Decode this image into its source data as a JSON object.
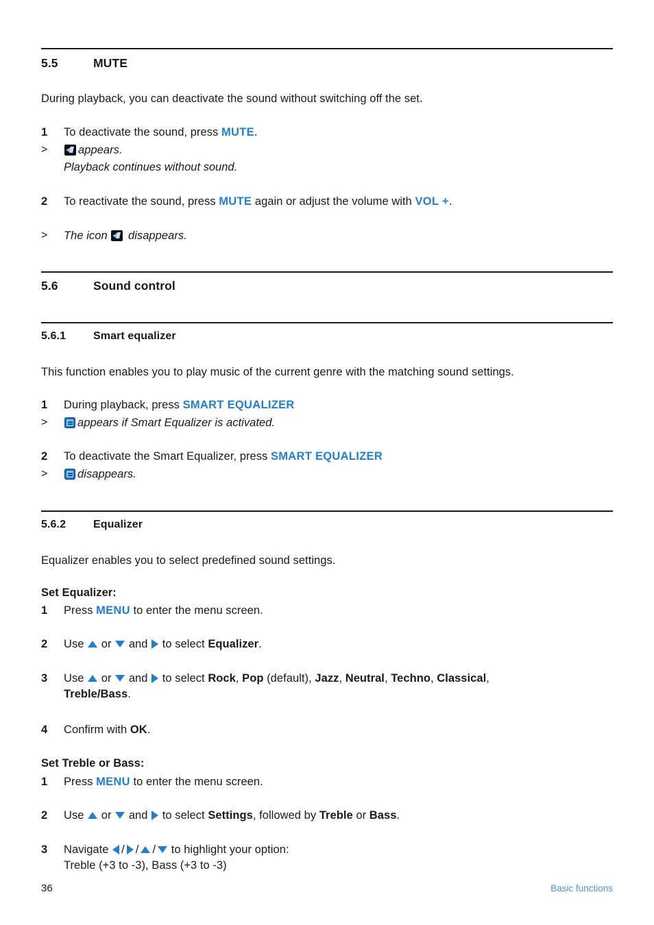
{
  "document": {
    "page_number": "36",
    "footer_section": "Basic functions",
    "accent_color": "#1f7fd1",
    "footer_color": "#4a90d9"
  },
  "sections": {
    "mute": {
      "number": "5.5",
      "title": "MUTE",
      "intro": "During playback, you can deactivate the sound without switching off the set.",
      "step1": {
        "marker": "1",
        "text_before": "To deactivate the sound, press ",
        "key": "MUTE",
        "text_after": "."
      },
      "result1": {
        "marker": ">",
        "icon": "mute-icon",
        "text": "appears."
      },
      "result1_line2": "Playback continues without sound.",
      "step2": {
        "marker": "2",
        "text_before": "To reactivate the sound, press ",
        "key1": "MUTE",
        "text_middle": " again or adjust the volume with ",
        "key2": "VOL +",
        "text_after": "."
      },
      "result2": {
        "marker": ">",
        "text_before": "The icon ",
        "icon": "mute-icon",
        "text_after": " disappears."
      }
    },
    "sound_control": {
      "number": "5.6",
      "title": "Sound control"
    },
    "smart_equalizer": {
      "number": "5.6.1",
      "title": "Smart equalizer",
      "intro": "This function enables you to play music of the current genre with the matching sound settings.",
      "step1": {
        "marker": "1",
        "text_before": "During playback, press ",
        "key": "SMART EQUALIZER"
      },
      "result1": {
        "marker": ">",
        "icon": "smart-equalizer-icon",
        "text": "appears if Smart Equalizer is activated."
      },
      "step2": {
        "marker": "2",
        "text_before": "To deactivate the Smart Equalizer, press ",
        "key": "SMART EQUALIZER"
      },
      "result2": {
        "marker": ">",
        "icon": "smart-equalizer-icon",
        "text": "disappears."
      }
    },
    "equalizer": {
      "number": "5.6.2",
      "title": "Equalizer",
      "intro": "Equalizer enables you to select predefined sound settings.",
      "set_equalizer": {
        "heading": "Set Equalizer:",
        "step1": {
          "marker": "1",
          "text_before": "Press ",
          "key": "MENU",
          "text_after": " to enter the menu screen."
        },
        "step2": {
          "marker": "2",
          "text_use": "Use ",
          "text_or": " or ",
          "text_and": " and ",
          "text_select": " to select ",
          "target": "Equalizer",
          "text_after": "."
        },
        "step3": {
          "marker": "3",
          "text_use": "Use ",
          "text_or": " or ",
          "text_and": " and ",
          "text_select": " to select ",
          "options": [
            "Rock",
            "Pop",
            "Jazz",
            "Neutral",
            "Techno",
            "Classical",
            "Treble/Bass"
          ],
          "default_note": " (default)",
          "text_after": "."
        },
        "step4": {
          "marker": "4",
          "text_before": "Confirm with ",
          "key": "OK",
          "text_after": "."
        }
      },
      "set_treble_bass": {
        "heading": "Set Treble or Bass:",
        "step1": {
          "marker": "1",
          "text_before": "Press ",
          "key": "MENU",
          "text_after": " to enter the menu screen."
        },
        "step2": {
          "marker": "2",
          "text_use": "Use ",
          "text_or": " or ",
          "text_and": " and ",
          "text_select": " to select ",
          "target1": "Settings",
          "text_followed": ", followed by ",
          "target2": "Treble",
          "text_or2": " or ",
          "target3": "Bass",
          "text_after": "."
        },
        "step3": {
          "marker": "3",
          "text_before": "Navigate ",
          "text_after": " to highlight your option:",
          "line2": "Treble (+3 to -3), Bass (+3 to -3)"
        }
      }
    }
  }
}
